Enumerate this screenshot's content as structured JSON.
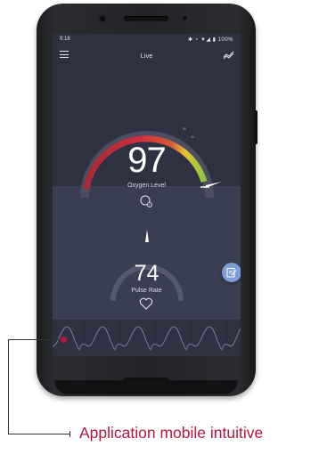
{
  "status_bar": {
    "time": "9:18",
    "icons": "✱ ◔ ▼◢ ▮ 100%",
    "battery": "100%"
  },
  "app_bar": {
    "title": "Live"
  },
  "oxygen": {
    "value": "97",
    "label": "Oxygen Level",
    "gauge_level": 0.97
  },
  "pulse": {
    "value": "74",
    "label": "Pulse Rate"
  },
  "caption": "Application mobile intuitive",
  "colors": {
    "screen_bg": "#2e3141",
    "panel_bg": "#3a3e52",
    "gauge_red": "#cf2f3c",
    "gauge_yellow": "#e8c233",
    "gauge_green": "#8cc63f",
    "accent_button": "#7e9cd6",
    "caption": "#b5163f"
  },
  "icons": [
    "menu-icon",
    "trend-icon",
    "o2-icon",
    "heart-icon",
    "note-edit-icon"
  ]
}
